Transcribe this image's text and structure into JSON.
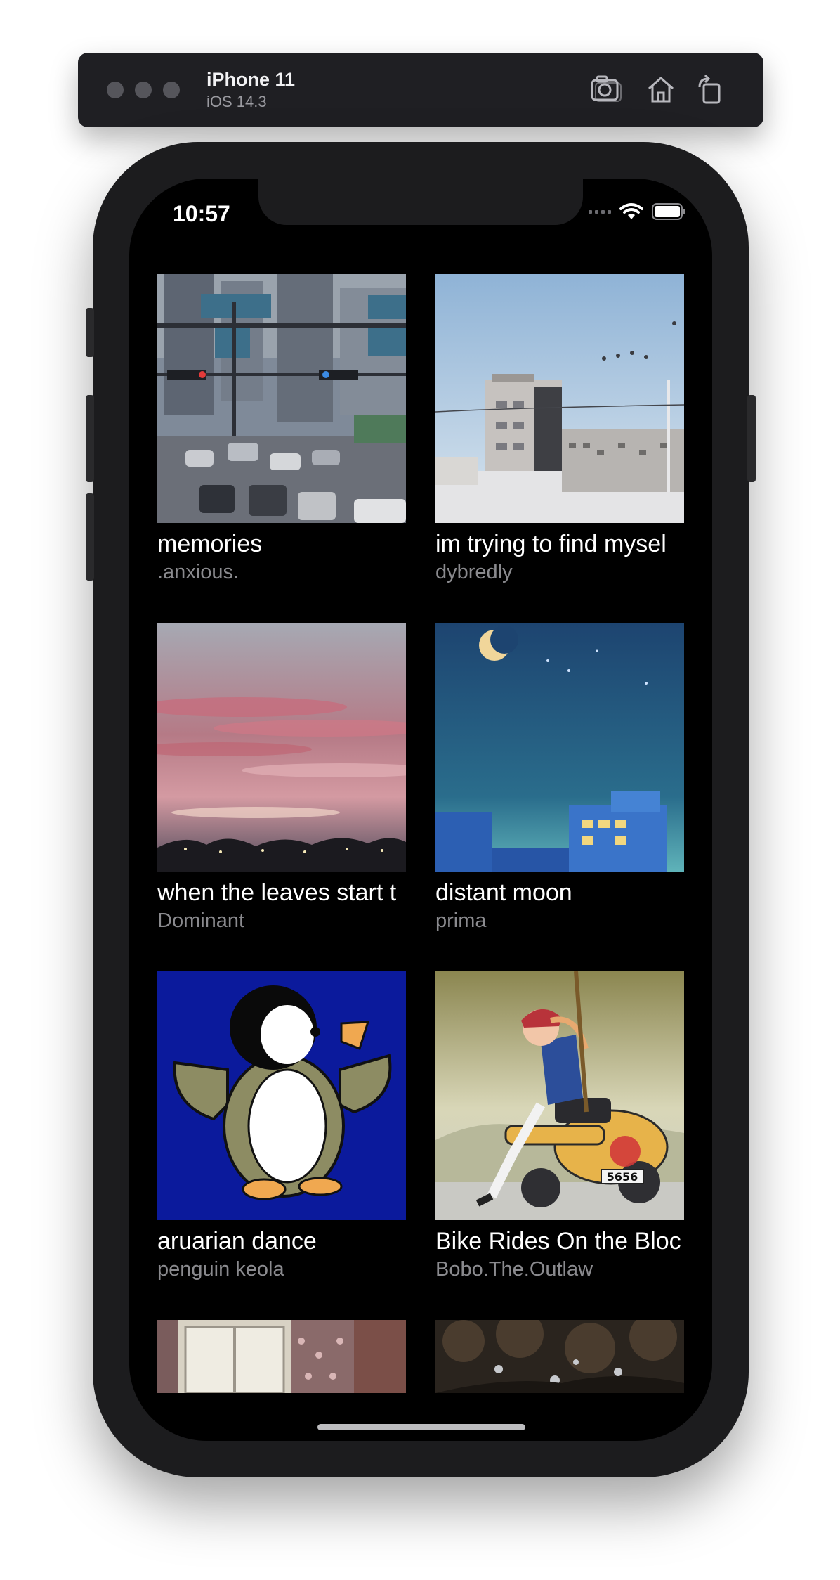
{
  "simulator": {
    "device_name": "iPhone 11",
    "os_version": "iOS 14.3",
    "icons": [
      "screenshot-icon",
      "home-icon",
      "rotate-icon"
    ]
  },
  "status_bar": {
    "time": "10:57"
  },
  "tracks": [
    {
      "title": "memories",
      "artist": ".anxious."
    },
    {
      "title": "im trying to find mysel",
      "artist": "dybredly"
    },
    {
      "title": "when the leaves start t",
      "artist": "Dominant"
    },
    {
      "title": "distant moon",
      "artist": "prima"
    },
    {
      "title": "aruarian dance",
      "artist": "penguin keola"
    },
    {
      "title": "Bike Rides On the Bloc",
      "artist": "Bobo.The.Outlaw"
    }
  ],
  "colors": {
    "background": "#000000",
    "title": "#ffffff",
    "subtitle": "#8a8a8e"
  }
}
